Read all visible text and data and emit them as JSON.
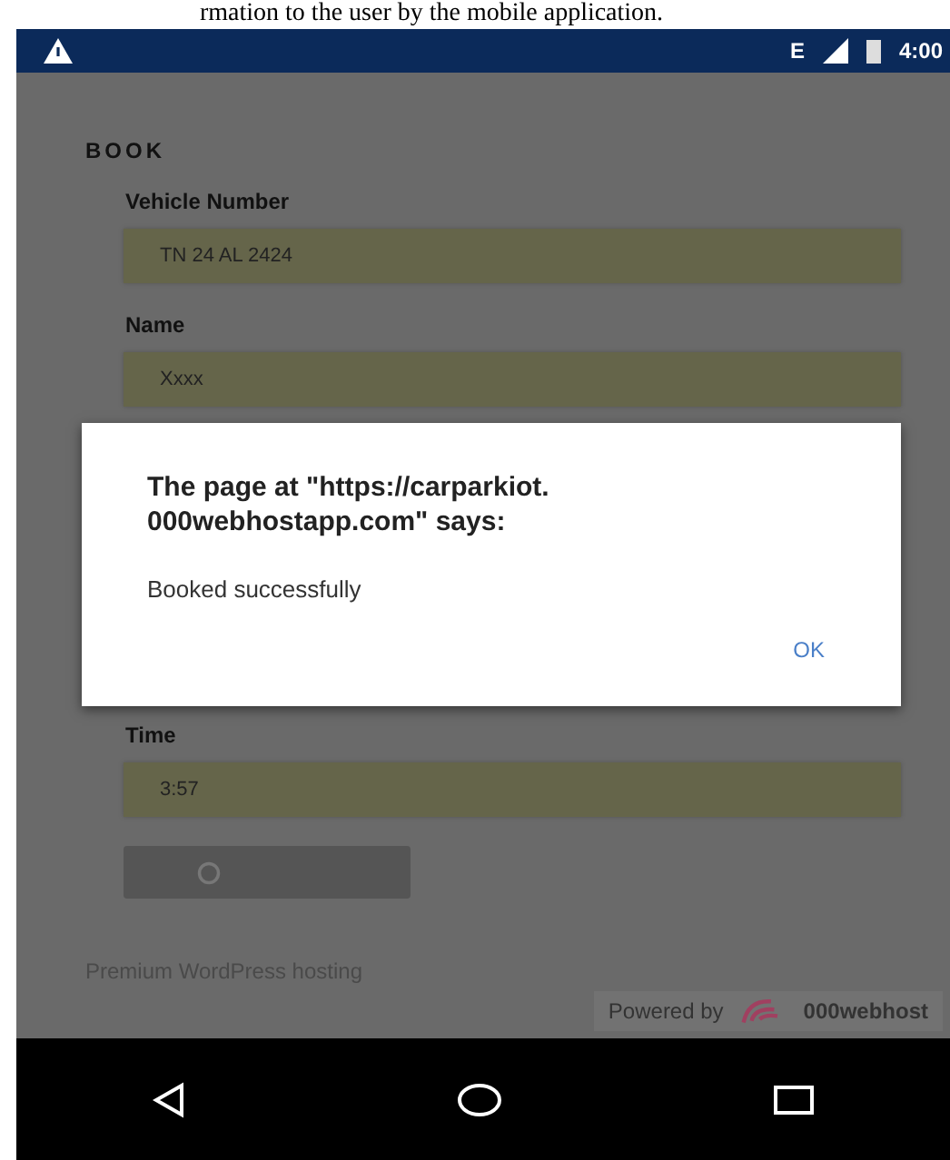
{
  "caption": "rmation to the user by the mobile application.",
  "status_bar": {
    "network": "E",
    "time": "4:00"
  },
  "form": {
    "title": "BOOK",
    "fields": [
      {
        "label": "Vehicle Number",
        "value": "TN 24 AL 2424"
      },
      {
        "label": "Name",
        "value": "Xxxx"
      },
      {
        "label": "Time",
        "value": "3:57"
      }
    ]
  },
  "dialog": {
    "message_title": "The page at \"https://carparkiot.\n000webhostapp.com\" says:",
    "message": "Booked successfully",
    "button": "OK"
  },
  "footer": {
    "link": "Premium WordPress hosting",
    "powered_by": "Powered by",
    "brand": "000webhost"
  }
}
